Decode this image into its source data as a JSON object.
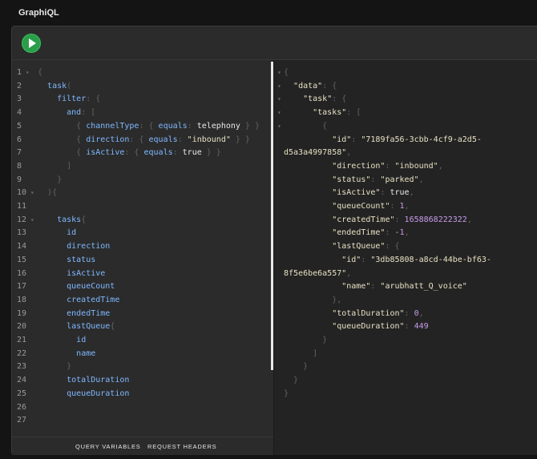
{
  "app": {
    "title": "GraphiQL"
  },
  "footer": {
    "query_variables": "QUERY VARIABLES",
    "request_headers": "REQUEST HEADERS"
  },
  "colors": {
    "run_button": "#2a9d4a",
    "keyword": "#7fb8ff",
    "string": "#e8e1c4",
    "number": "#c79ceb",
    "punctuation": "#626262"
  },
  "query_lines": [
    {
      "n": "1",
      "fold": true,
      "segs": [
        [
          "p",
          "{"
        ]
      ]
    },
    {
      "n": "2",
      "fold": false,
      "segs": [
        [
          "s",
          "  "
        ],
        [
          "k",
          "task"
        ],
        [
          "p",
          "("
        ]
      ]
    },
    {
      "n": "3",
      "fold": false,
      "segs": [
        [
          "s",
          "    "
        ],
        [
          "k",
          "filter"
        ],
        [
          "p",
          ": {"
        ]
      ]
    },
    {
      "n": "4",
      "fold": false,
      "segs": [
        [
          "s",
          "      "
        ],
        [
          "k",
          "and"
        ],
        [
          "p",
          ": ["
        ]
      ]
    },
    {
      "n": "5",
      "fold": false,
      "segs": [
        [
          "s",
          "        "
        ],
        [
          "p",
          "{ "
        ],
        [
          "k",
          "channelType"
        ],
        [
          "p",
          ": { "
        ],
        [
          "k",
          "equals"
        ],
        [
          "p",
          ": "
        ],
        [
          "v",
          "telephony"
        ],
        [
          "p",
          " } }"
        ]
      ]
    },
    {
      "n": "6",
      "fold": false,
      "segs": [
        [
          "s",
          "        "
        ],
        [
          "p",
          "{ "
        ],
        [
          "k",
          "direction"
        ],
        [
          "p",
          ": { "
        ],
        [
          "k",
          "equals"
        ],
        [
          "p",
          ": "
        ],
        [
          "s",
          "\"inbound\""
        ],
        [
          "p",
          " } }"
        ]
      ]
    },
    {
      "n": "7",
      "fold": false,
      "segs": [
        [
          "s",
          "        "
        ],
        [
          "p",
          "{ "
        ],
        [
          "k",
          "isActive"
        ],
        [
          "p",
          ": { "
        ],
        [
          "k",
          "equals"
        ],
        [
          "p",
          ": "
        ],
        [
          "v",
          "true"
        ],
        [
          "p",
          " } }"
        ]
      ]
    },
    {
      "n": "8",
      "fold": false,
      "segs": [
        [
          "s",
          "      "
        ],
        [
          "p",
          "]"
        ]
      ]
    },
    {
      "n": "9",
      "fold": false,
      "segs": [
        [
          "s",
          "    "
        ],
        [
          "p",
          "}"
        ]
      ]
    },
    {
      "n": "10",
      "fold": true,
      "segs": [
        [
          "s",
          "  "
        ],
        [
          "p",
          "){"
        ]
      ]
    },
    {
      "n": "11",
      "fold": false,
      "segs": []
    },
    {
      "n": "12",
      "fold": true,
      "segs": [
        [
          "s",
          "    "
        ],
        [
          "k",
          "tasks"
        ],
        [
          "p",
          "{"
        ]
      ]
    },
    {
      "n": "13",
      "fold": false,
      "segs": [
        [
          "s",
          "      "
        ],
        [
          "k",
          "id"
        ]
      ]
    },
    {
      "n": "14",
      "fold": false,
      "segs": [
        [
          "s",
          "      "
        ],
        [
          "k",
          "direction"
        ]
      ]
    },
    {
      "n": "15",
      "fold": false,
      "segs": [
        [
          "s",
          "      "
        ],
        [
          "k",
          "status"
        ]
      ]
    },
    {
      "n": "16",
      "fold": false,
      "segs": [
        [
          "s",
          "      "
        ],
        [
          "k",
          "isActive"
        ]
      ]
    },
    {
      "n": "17",
      "fold": false,
      "segs": [
        [
          "s",
          "      "
        ],
        [
          "k",
          "queueCount"
        ]
      ]
    },
    {
      "n": "18",
      "fold": false,
      "segs": [
        [
          "s",
          "      "
        ],
        [
          "k",
          "createdTime"
        ]
      ]
    },
    {
      "n": "19",
      "fold": false,
      "segs": [
        [
          "s",
          "      "
        ],
        [
          "k",
          "endedTime"
        ]
      ]
    },
    {
      "n": "20",
      "fold": false,
      "segs": [
        [
          "s",
          "      "
        ],
        [
          "k",
          "lastQueue"
        ],
        [
          "p",
          "{"
        ]
      ]
    },
    {
      "n": "21",
      "fold": false,
      "segs": [
        [
          "s",
          "        "
        ],
        [
          "k",
          "id"
        ]
      ]
    },
    {
      "n": "22",
      "fold": false,
      "segs": [
        [
          "s",
          "        "
        ],
        [
          "k",
          "name"
        ]
      ]
    },
    {
      "n": "23",
      "fold": false,
      "segs": [
        [
          "s",
          "      "
        ],
        [
          "p",
          "}"
        ]
      ]
    },
    {
      "n": "24",
      "fold": false,
      "segs": [
        [
          "s",
          "      "
        ],
        [
          "k",
          "totalDuration"
        ]
      ]
    },
    {
      "n": "25",
      "fold": false,
      "segs": [
        [
          "s",
          "      "
        ],
        [
          "k",
          "queueDuration"
        ]
      ]
    },
    {
      "n": "26",
      "fold": false,
      "segs": []
    },
    {
      "n": "27",
      "fold": false,
      "segs": []
    }
  ],
  "result_lines": [
    {
      "fold": true,
      "segs": [
        [
          "p",
          "{"
        ]
      ]
    },
    {
      "fold": true,
      "segs": [
        [
          "s",
          "  "
        ],
        [
          "s",
          "\"data\""
        ],
        [
          "p",
          ": {"
        ]
      ]
    },
    {
      "fold": true,
      "segs": [
        [
          "s",
          "    "
        ],
        [
          "s",
          "\"task\""
        ],
        [
          "p",
          ": {"
        ]
      ]
    },
    {
      "fold": true,
      "segs": [
        [
          "s",
          "      "
        ],
        [
          "s",
          "\"tasks\""
        ],
        [
          "p",
          ": ["
        ]
      ]
    },
    {
      "fold": true,
      "segs": [
        [
          "s",
          "        "
        ],
        [
          "p",
          "{"
        ]
      ]
    },
    {
      "fold": false,
      "segs": [
        [
          "s",
          "          "
        ],
        [
          "s",
          "\"id\""
        ],
        [
          "p",
          ": "
        ],
        [
          "s",
          "\"7189fa56-3cbb-4cf9-a2d5-"
        ]
      ]
    },
    {
      "fold": false,
      "segs": [
        [
          "s",
          "d5a3a4997858\""
        ],
        [
          "p",
          ","
        ]
      ]
    },
    {
      "fold": false,
      "segs": [
        [
          "s",
          "          "
        ],
        [
          "s",
          "\"direction\""
        ],
        [
          "p",
          ": "
        ],
        [
          "s",
          "\"inbound\""
        ],
        [
          "p",
          ","
        ]
      ]
    },
    {
      "fold": false,
      "segs": [
        [
          "s",
          "          "
        ],
        [
          "s",
          "\"status\""
        ],
        [
          "p",
          ": "
        ],
        [
          "s",
          "\"parked\""
        ],
        [
          "p",
          ","
        ]
      ]
    },
    {
      "fold": false,
      "segs": [
        [
          "s",
          "          "
        ],
        [
          "s",
          "\"isActive\""
        ],
        [
          "p",
          ": "
        ],
        [
          "v",
          "true"
        ],
        [
          "p",
          ","
        ]
      ]
    },
    {
      "fold": false,
      "segs": [
        [
          "s",
          "          "
        ],
        [
          "s",
          "\"queueCount\""
        ],
        [
          "p",
          ": "
        ],
        [
          "n",
          "1"
        ],
        [
          "p",
          ","
        ]
      ]
    },
    {
      "fold": false,
      "segs": [
        [
          "s",
          "          "
        ],
        [
          "s",
          "\"createdTime\""
        ],
        [
          "p",
          ": "
        ],
        [
          "n",
          "1658868222322"
        ],
        [
          "p",
          ","
        ]
      ]
    },
    {
      "fold": false,
      "segs": [
        [
          "s",
          "          "
        ],
        [
          "s",
          "\"endedTime\""
        ],
        [
          "p",
          ": "
        ],
        [
          "n",
          "-1"
        ],
        [
          "p",
          ","
        ]
      ]
    },
    {
      "fold": false,
      "segs": [
        [
          "s",
          "          "
        ],
        [
          "s",
          "\"lastQueue\""
        ],
        [
          "p",
          ": {"
        ]
      ]
    },
    {
      "fold": false,
      "segs": [
        [
          "s",
          "            "
        ],
        [
          "s",
          "\"id\""
        ],
        [
          "p",
          ": "
        ],
        [
          "s",
          "\"3db85808-a8cd-44be-bf63-"
        ]
      ]
    },
    {
      "fold": false,
      "segs": [
        [
          "s",
          "8f5e6be6a557\""
        ],
        [
          "p",
          ","
        ]
      ]
    },
    {
      "fold": false,
      "segs": [
        [
          "s",
          "            "
        ],
        [
          "s",
          "\"name\""
        ],
        [
          "p",
          ": "
        ],
        [
          "s",
          "\"arubhatt_Q_voice\""
        ]
      ]
    },
    {
      "fold": false,
      "segs": [
        [
          "s",
          "          "
        ],
        [
          "p",
          "},"
        ]
      ]
    },
    {
      "fold": false,
      "segs": [
        [
          "s",
          "          "
        ],
        [
          "s",
          "\"totalDuration\""
        ],
        [
          "p",
          ": "
        ],
        [
          "n",
          "0"
        ],
        [
          "p",
          ","
        ]
      ]
    },
    {
      "fold": false,
      "segs": [
        [
          "s",
          "          "
        ],
        [
          "s",
          "\"queueDuration\""
        ],
        [
          "p",
          ": "
        ],
        [
          "n",
          "449"
        ]
      ]
    },
    {
      "fold": false,
      "segs": [
        [
          "s",
          "        "
        ],
        [
          "p",
          "}"
        ]
      ]
    },
    {
      "fold": false,
      "segs": [
        [
          "s",
          "      "
        ],
        [
          "p",
          "]"
        ]
      ]
    },
    {
      "fold": false,
      "segs": [
        [
          "s",
          "    "
        ],
        [
          "p",
          "}"
        ]
      ]
    },
    {
      "fold": false,
      "segs": [
        [
          "s",
          "  "
        ],
        [
          "p",
          "}"
        ]
      ]
    },
    {
      "fold": false,
      "segs": [
        [
          "p",
          "}"
        ]
      ]
    }
  ]
}
